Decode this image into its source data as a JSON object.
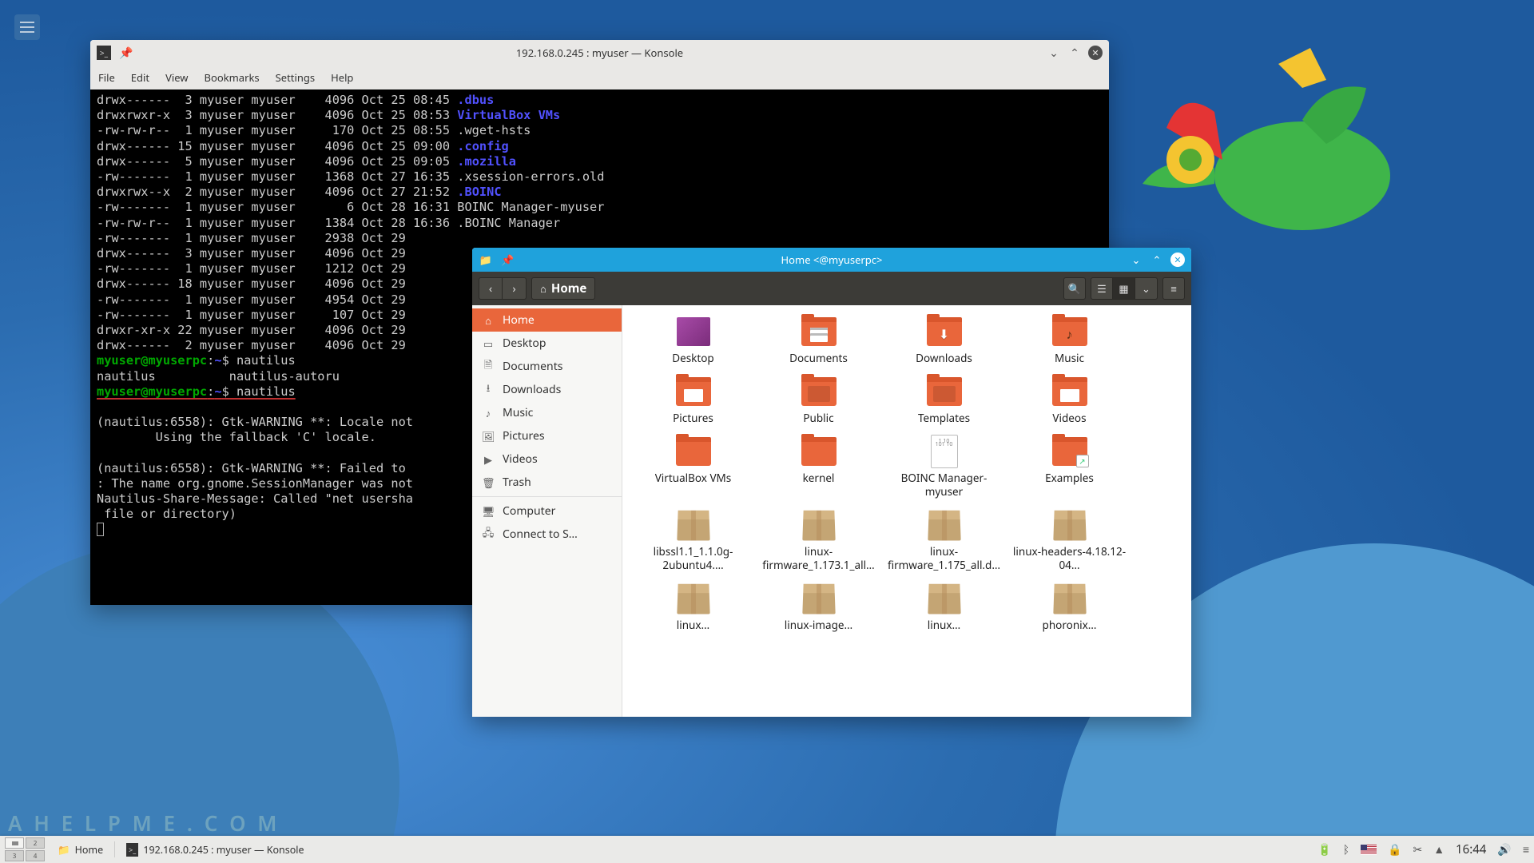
{
  "desktop": {
    "watermark": "A H E L P M E . C O M"
  },
  "konsole": {
    "title": "192.168.0.245 : myuser — Konsole",
    "menu": [
      "File",
      "Edit",
      "View",
      "Bookmarks",
      "Settings",
      "Help"
    ],
    "prompt_user": "myuser@myuserpc",
    "prompt_path": "~",
    "cmd1": "nautilus",
    "completion": "nautilus          nautilus-autoru",
    "cmd2": "nautilus",
    "ls": [
      {
        "perm": "drwx------",
        "n": " 3",
        "u": "myuser",
        "g": "myuser",
        "sz": "   4096",
        "dt": "Oct 25 08:45",
        "name": ".dbus",
        "cls": "dir"
      },
      {
        "perm": "drwxrwxr-x",
        "n": " 3",
        "u": "myuser",
        "g": "myuser",
        "sz": "   4096",
        "dt": "Oct 25 08:53",
        "name": "VirtualBox VMs",
        "cls": "dir"
      },
      {
        "perm": "-rw-rw-r--",
        "n": " 1",
        "u": "myuser",
        "g": "myuser",
        "sz": "    170",
        "dt": "Oct 25 08:55",
        "name": ".wget-hsts",
        "cls": ""
      },
      {
        "perm": "drwx------",
        "n": "15",
        "u": "myuser",
        "g": "myuser",
        "sz": "   4096",
        "dt": "Oct 25 09:00",
        "name": ".config",
        "cls": "dir"
      },
      {
        "perm": "drwx------",
        "n": " 5",
        "u": "myuser",
        "g": "myuser",
        "sz": "   4096",
        "dt": "Oct 25 09:05",
        "name": ".mozilla",
        "cls": "dir"
      },
      {
        "perm": "-rw-------",
        "n": " 1",
        "u": "myuser",
        "g": "myuser",
        "sz": "   1368",
        "dt": "Oct 27 16:35",
        "name": ".xsession-errors.old",
        "cls": ""
      },
      {
        "perm": "drwxrwx--x",
        "n": " 2",
        "u": "myuser",
        "g": "myuser",
        "sz": "   4096",
        "dt": "Oct 27 21:52",
        "name": ".BOINC",
        "cls": "dir"
      },
      {
        "perm": "-rw-------",
        "n": " 1",
        "u": "myuser",
        "g": "myuser",
        "sz": "      6",
        "dt": "Oct 28 16:31",
        "name": "BOINC Manager-myuser",
        "cls": ""
      },
      {
        "perm": "-rw-rw-r--",
        "n": " 1",
        "u": "myuser",
        "g": "myuser",
        "sz": "   1384",
        "dt": "Oct 28 16:36",
        "name": ".BOINC Manager",
        "cls": ""
      },
      {
        "perm": "-rw-------",
        "n": " 1",
        "u": "myuser",
        "g": "myuser",
        "sz": "   2938",
        "dt": "Oct 29",
        "name": "",
        "cls": ""
      },
      {
        "perm": "drwx------",
        "n": " 3",
        "u": "myuser",
        "g": "myuser",
        "sz": "   4096",
        "dt": "Oct 29",
        "name": "",
        "cls": ""
      },
      {
        "perm": "-rw-------",
        "n": " 1",
        "u": "myuser",
        "g": "myuser",
        "sz": "   1212",
        "dt": "Oct 29",
        "name": "",
        "cls": ""
      },
      {
        "perm": "drwx------",
        "n": "18",
        "u": "myuser",
        "g": "myuser",
        "sz": "   4096",
        "dt": "Oct 29",
        "name": "",
        "cls": ""
      },
      {
        "perm": "-rw-------",
        "n": " 1",
        "u": "myuser",
        "g": "myuser",
        "sz": "   4954",
        "dt": "Oct 29",
        "name": "",
        "cls": ""
      },
      {
        "perm": "-rw-------",
        "n": " 1",
        "u": "myuser",
        "g": "myuser",
        "sz": "    107",
        "dt": "Oct 29",
        "name": "",
        "cls": ""
      },
      {
        "perm": "drwxr-xr-x",
        "n": "22",
        "u": "myuser",
        "g": "myuser",
        "sz": "   4096",
        "dt": "Oct 29",
        "name": "",
        "cls": ""
      },
      {
        "perm": "drwx------",
        "n": " 2",
        "u": "myuser",
        "g": "myuser",
        "sz": "   4096",
        "dt": "Oct 29",
        "name": "",
        "cls": ""
      }
    ],
    "warn1": "(nautilus:6558): Gtk-WARNING **: Locale not",
    "warn1b": "        Using the fallback 'C' locale.",
    "warn2": "(nautilus:6558): Gtk-WARNING **: Failed to ",
    "warn2b": ": The name org.gnome.SessionManager was not",
    "warn3": "Nautilus-Share-Message: Called \"net usersha",
    "warn3b": " file or directory)"
  },
  "nautilus": {
    "title": "Home <@myuserpc>",
    "path_label": "Home",
    "sidebar": [
      {
        "icon": "⌂",
        "label": "Home",
        "active": true
      },
      {
        "icon": "▭",
        "label": "Desktop"
      },
      {
        "icon": "🗎",
        "label": "Documents"
      },
      {
        "icon": "⭳",
        "label": "Downloads"
      },
      {
        "icon": "♪",
        "label": "Music"
      },
      {
        "icon": "🖼",
        "label": "Pictures"
      },
      {
        "icon": "▶",
        "label": "Videos"
      },
      {
        "icon": "🗑",
        "label": "Trash"
      },
      {
        "sep": true
      },
      {
        "icon": "🖥",
        "label": "Computer"
      },
      {
        "icon": "🖧",
        "label": "Connect to S…"
      }
    ],
    "files": [
      {
        "name": "Desktop",
        "type": "folder-desktop"
      },
      {
        "name": "Documents",
        "type": "folder folder-docs"
      },
      {
        "name": "Downloads",
        "type": "folder folder-dl"
      },
      {
        "name": "Music",
        "type": "folder folder-music"
      },
      {
        "name": "Pictures",
        "type": "folder folder-pics"
      },
      {
        "name": "Public",
        "type": "folder folder-public"
      },
      {
        "name": "Templates",
        "type": "folder folder-tmpl"
      },
      {
        "name": "Videos",
        "type": "folder folder-vids"
      },
      {
        "name": "VirtualBox VMs",
        "type": "folder"
      },
      {
        "name": "kernel",
        "type": "folder"
      },
      {
        "name": "BOINC Manager-myuser",
        "type": "file"
      },
      {
        "name": "Examples",
        "type": "folder folder-link"
      },
      {
        "name": "libssl1.1_1.1.0g-2ubuntu4.…",
        "type": "pkg"
      },
      {
        "name": "linux-firmware_1.173.1_all…",
        "type": "pkg"
      },
      {
        "name": "linux-firmware_1.175_all.d…",
        "type": "pkg"
      },
      {
        "name": "linux-headers-4.18.12-04…",
        "type": "pkg"
      },
      {
        "name": "linux…",
        "type": "pkg"
      },
      {
        "name": "linux-image…",
        "type": "pkg"
      },
      {
        "name": "linux…",
        "type": "pkg"
      },
      {
        "name": "phoronix…",
        "type": "pkg"
      }
    ]
  },
  "taskbar": {
    "tasks": [
      {
        "icon": "folder",
        "label": "Home"
      },
      {
        "icon": "term",
        "label": "192.168.0.245 : myuser — Konsole"
      }
    ],
    "clock": "16:44"
  }
}
